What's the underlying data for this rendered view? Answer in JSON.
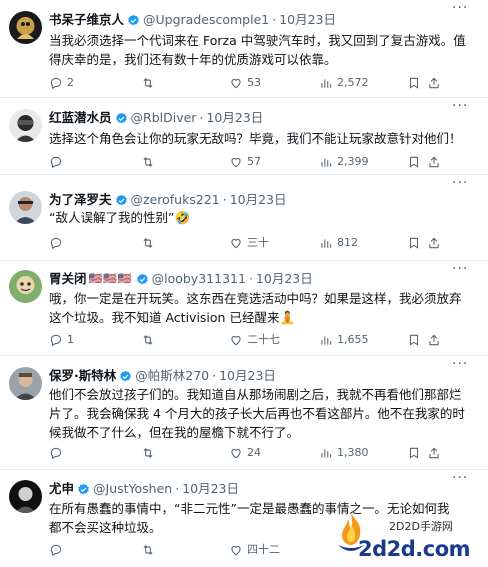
{
  "tweets": [
    {
      "name": "书呆子维京人",
      "handle": "@Upgradescomple1",
      "date": "10月23日",
      "flags": "",
      "text": "当我必须选择一个代词来在 Forza 中驾驶汽车时，我又回到了复古游戏。值得庆幸的是，我们还有数十年的优质游戏可以依靠。",
      "replies": "2",
      "retweets": "",
      "likes": "53",
      "views": "2,572"
    },
    {
      "name": "红蓝潜水员",
      "handle": "@RblDiver",
      "date": "10月23日",
      "flags": "",
      "text": "选择这个角色会让你的玩家无敌吗？毕竟，我们不能让玩家故意针对他们！",
      "replies": "",
      "retweets": "",
      "likes": "57",
      "views": "2,399"
    },
    {
      "name": "为了泽罗夫",
      "handle": "@zerofuks221",
      "date": "10月23日",
      "flags": "",
      "text": "“敌人误解了我的性别”🤣",
      "replies": "",
      "retweets": "",
      "likes": "三十",
      "views": "812"
    },
    {
      "name": "胃关闭",
      "handle": "@looby311311",
      "date": "10月23日",
      "flags": "🇺🇸🇺🇸🇺🇸",
      "text": "哦，你一定是在开玩笑。这东西在竞选活动中吗？如果是这样，我必须放弃这个垃圾。我不知道 Activision 已经醒来🧘",
      "replies": "1",
      "retweets": "",
      "likes": "二十七",
      "views": "1,655"
    },
    {
      "name": "保罗·斯特林",
      "handle": "@帕斯林270",
      "date": "10月23日",
      "flags": "",
      "text": "他们不会放过孩子们的。我知道自从那场闹剧之后，我就不再看他们那部烂片了。我会确保我 4 个月大的孩子长大后再也不看这部片。他不在我家的时候我做不了什么，但在我的屋檐下就不行了。",
      "replies": "",
      "retweets": "",
      "likes": "24",
      "views": "1,380"
    },
    {
      "name": "尤申",
      "handle": "@JustYoshen",
      "date": "10月23日",
      "flags": "",
      "text": "在所有愚蠢的事情中，“非二元性”一定是最愚蠢的事情之一。无论如何我都不会买这种垃圾。",
      "replies": "",
      "retweets": "",
      "likes": "四十二",
      "views": ""
    }
  ],
  "watermark": {
    "site_cn": "2D2D手游网",
    "url": "2d2d.com"
  },
  "colors": {
    "text": "#0f1419",
    "secondary": "#536471",
    "verified": "#1d9bf0",
    "divider": "#e6ecf0",
    "watermark_blue": "#1b3a8c"
  },
  "icons": {
    "reply": "reply-icon",
    "retweet": "retweet-icon",
    "like": "heart-icon",
    "views": "views-icon",
    "bookmark": "bookmark-icon",
    "share": "share-icon",
    "more": "more-icon",
    "verified": "verified-badge-icon"
  }
}
